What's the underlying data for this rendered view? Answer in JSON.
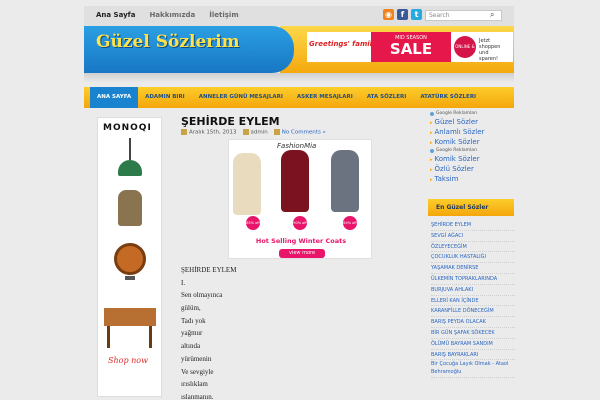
{
  "topnav": {
    "items": [
      "Ana Sayfa",
      "Hakkımızda",
      "İletişim"
    ]
  },
  "search": {
    "placeholder": "Search"
  },
  "header": {
    "logo": "Güzel Sözlerim",
    "ad": {
      "brand": "Greetings' family",
      "sale_top": "MID SEASON",
      "sale": "SALE",
      "badge": "ONLINE & IN STORES",
      "right": "Jetzt shoppen und sparen!"
    }
  },
  "nav": {
    "items": [
      "ANA SAYFA",
      "ADAMIN BIRI",
      "ANNELER GÜNÜ MESAJLARI",
      "ASKER MESAJLARI",
      "ATA SÖZLERI",
      "ATATÜRK SÖZLERI"
    ]
  },
  "left_ad": {
    "brand": "MONOQI",
    "cta": "Shop now"
  },
  "post": {
    "title": "ŞEHİRDE EYLEM",
    "date": "Aralık 15th, 2013",
    "author": "admin",
    "comments": "No Comments »",
    "lines": [
      "ŞEHİRDE EYLEM",
      "I.",
      "Sen olmayınca",
      "gülüm,",
      "Tadı yok",
      "yağmur",
      "altında",
      "yürümenin",
      "Ve sevgiyle",
      "ırıslıklam",
      "ıslanmanın."
    ]
  },
  "content_ad": {
    "brand": "FashionMia",
    "discounts": [
      "85% off",
      "90% off",
      "64% off"
    ],
    "title": "Hot Selling Winter Coats",
    "button": "view more"
  },
  "sidebar": {
    "ads_label_1": "Google Reklamları",
    "links_1": [
      "Güzel Sözler",
      "Anlamlı Sözler",
      "Komik Sözler"
    ],
    "ads_label_2": "Google Reklamları",
    "links_2": [
      "Komik Sözler",
      "Özlü Sözler",
      "Taksim"
    ],
    "widget_title": "En Güzel Sözler",
    "widget_items": [
      "ŞEHİRDE EYLEM",
      "SEVGİ AĞACI",
      "ÖZLEYECEĞİM",
      "ÇOCUKLUK HASTALIĞI",
      "YAŞAMAK DENİRSE",
      "ÜLKEMİN TOPRAKLARINDA",
      "BURJUVA AHLAKI",
      "ELLERİ KAN İÇİNDE",
      "KARANFİLLE DÖNECEĞİM",
      "BARIŞ PEYDA OLACAK",
      "BİR GÜN ŞAFAK SÖKECEK",
      "ÖLÜMÜ BAYRAM SANDIM",
      "BARIŞ BAYRAKLARI",
      "Bir Çocuğa Layık Olmak - Ataol Behramoğlu"
    ]
  },
  "colors": {
    "accent_blue": "#1a83d0",
    "accent_yellow": "#f4a60c",
    "link": "#2a66c2"
  }
}
